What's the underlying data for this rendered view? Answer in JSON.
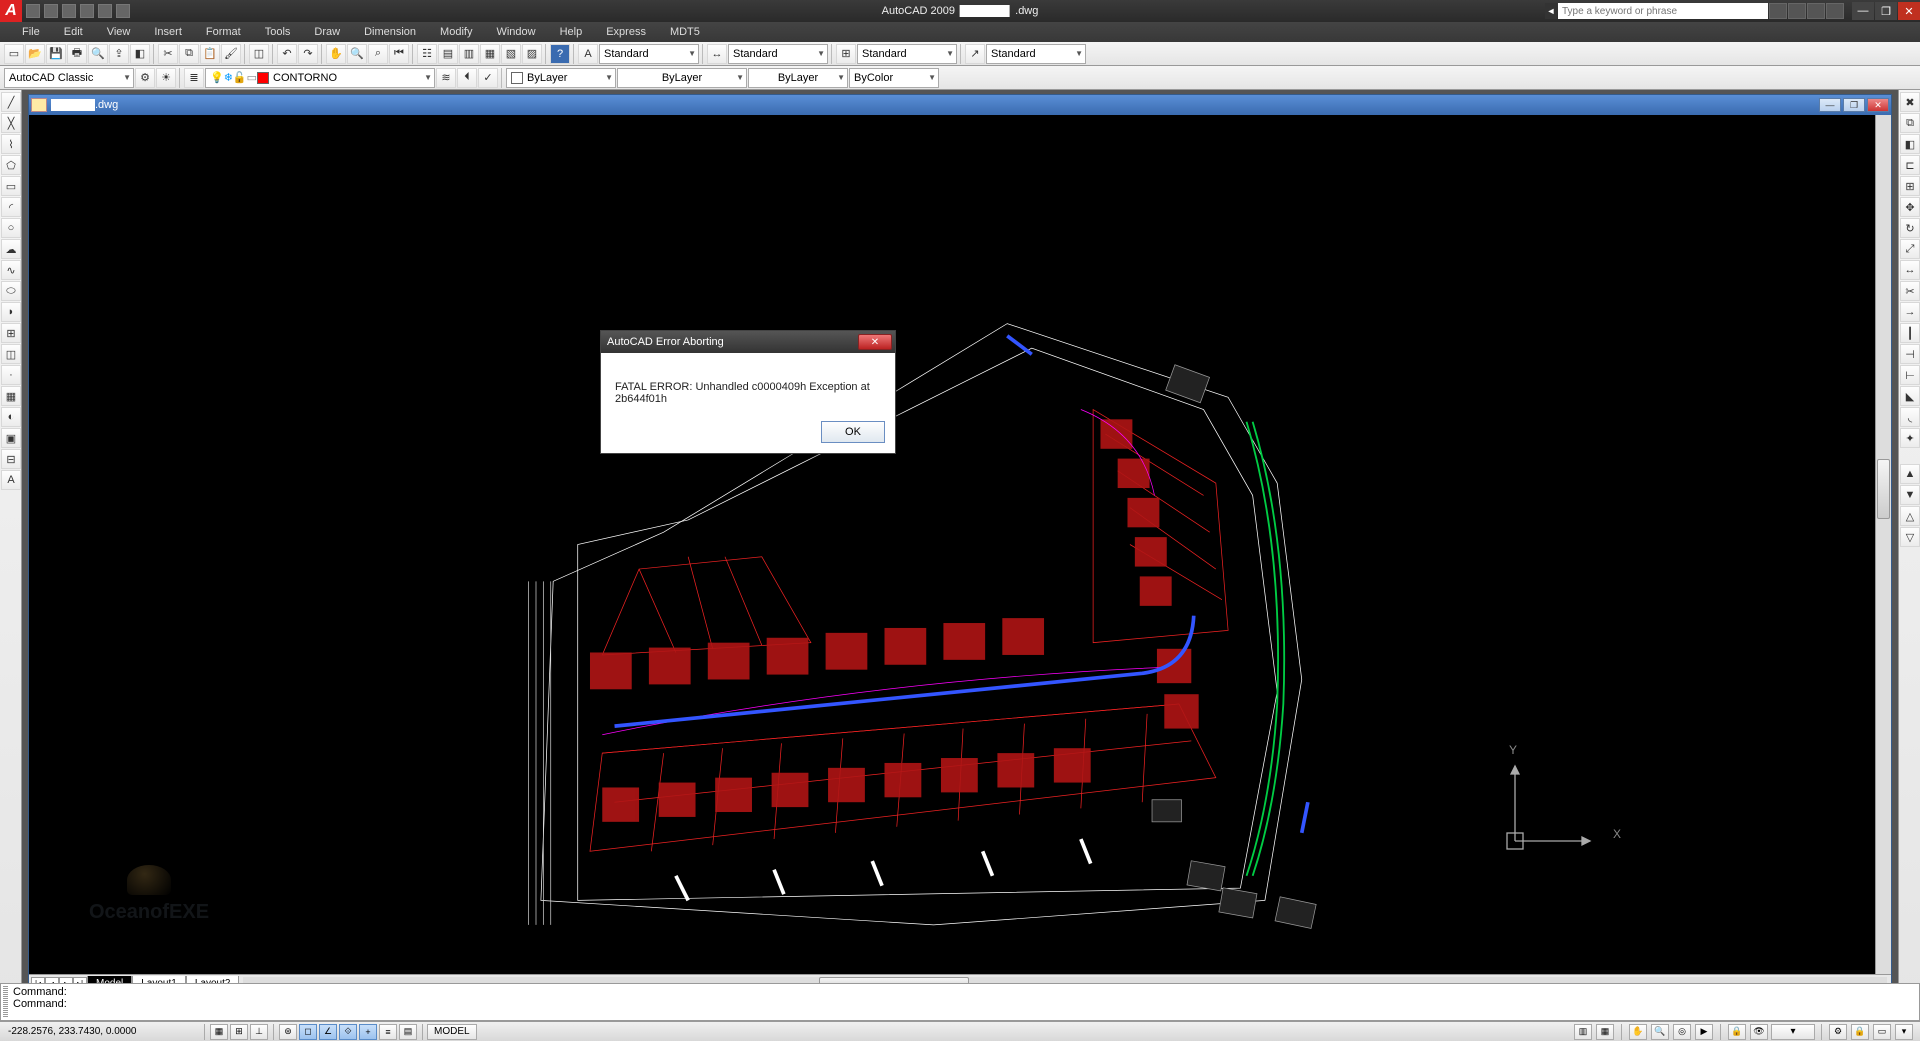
{
  "title_app": "AutoCAD 2009",
  "title_file": ".dwg",
  "search_placeholder": "Type a keyword or phrase",
  "menu": [
    "File",
    "Edit",
    "View",
    "Insert",
    "Format",
    "Tools",
    "Draw",
    "Dimension",
    "Modify",
    "Window",
    "Help",
    "Express",
    "MDT5"
  ],
  "toolbars": {
    "workspace_combo": "AutoCAD Classic",
    "layer_combo": "CONTORNO",
    "style1": "Standard",
    "style2": "Standard",
    "style3": "Standard",
    "style4": "Standard",
    "linecolor": "ByLayer",
    "linetype": "ByLayer",
    "lineweight": "ByLayer",
    "plotstyle": "ByColor"
  },
  "doc_title": ".dwg",
  "tabs": {
    "model": "Model",
    "l1": "Layout1",
    "l2": "Layout2"
  },
  "ucs": {
    "x": "X",
    "y": "Y"
  },
  "error": {
    "title": "AutoCAD Error Aborting",
    "message": "FATAL ERROR:  Unhandled c0000409h Exception at 2b644f01h",
    "ok": "OK"
  },
  "cmd1": "Command:",
  "cmd2": "Command:",
  "coords": "-228.2576, 233.7430, 0.0000",
  "status_model": "MODEL",
  "watermark": "OceanofEXE"
}
